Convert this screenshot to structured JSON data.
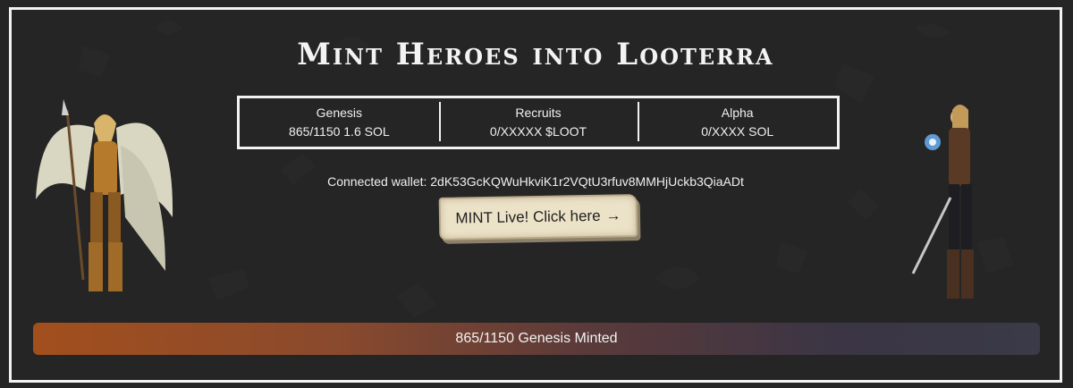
{
  "title": "Mint Heroes into Looterra",
  "stats": [
    {
      "label": "Genesis",
      "value": "865/1150 1.6 SOL"
    },
    {
      "label": "Recruits",
      "value": "0/XXXXX $LOOT"
    },
    {
      "label": "Alpha",
      "value": "0/XXXX SOL"
    }
  ],
  "wallet": {
    "text": "Connected wallet: 2dK53GcKQWuHkviK1r2VQtU3rfuv8MMHjUckb3QiaADt"
  },
  "mint_button": {
    "label": "MINT Live! Click here",
    "arrow": "→"
  },
  "progress": {
    "text": "865/1150 Genesis Minted",
    "minted": 865,
    "total": 1150
  },
  "icons": {
    "left_hero": "angel-warrior-illustration",
    "right_hero": "sword-mage-illustration"
  },
  "colors": {
    "background": "#252525",
    "border": "#f2f2f2",
    "button_bg": "#ece2c8",
    "progress_start": "#a24f1d",
    "progress_end": "#3a3a48"
  }
}
